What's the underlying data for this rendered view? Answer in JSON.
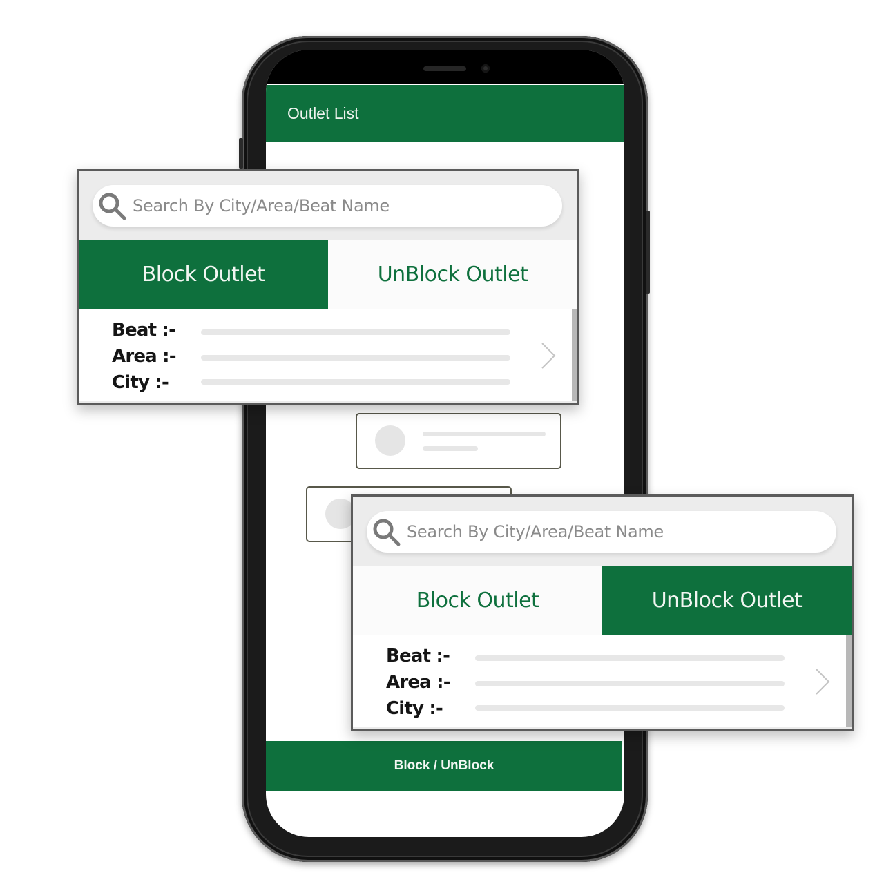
{
  "app": {
    "title": "Outlet List",
    "bottom_button_label": "Block / UnBlock",
    "brand_color": "#0e703d"
  },
  "panels": [
    {
      "search": {
        "placeholder": "Search By City/Area/Beat Name",
        "icon": "search-icon"
      },
      "tabs": [
        {
          "label": "Block Outlet",
          "active": true
        },
        {
          "label": "UnBlock Outlet",
          "active": false
        }
      ],
      "fields": [
        {
          "label": "Beat :-"
        },
        {
          "label": "Area :-"
        },
        {
          "label": "City  :-"
        }
      ],
      "chevron_icon": "chevron-right-icon"
    },
    {
      "search": {
        "placeholder": "Search By City/Area/Beat Name",
        "icon": "search-icon"
      },
      "tabs": [
        {
          "label": "Block Outlet",
          "active": false
        },
        {
          "label": "UnBlock Outlet",
          "active": true
        }
      ],
      "fields": [
        {
          "label": "Beat :-"
        },
        {
          "label": "Area :-"
        },
        {
          "label": "City  :-"
        }
      ],
      "chevron_icon": "chevron-right-icon"
    }
  ]
}
